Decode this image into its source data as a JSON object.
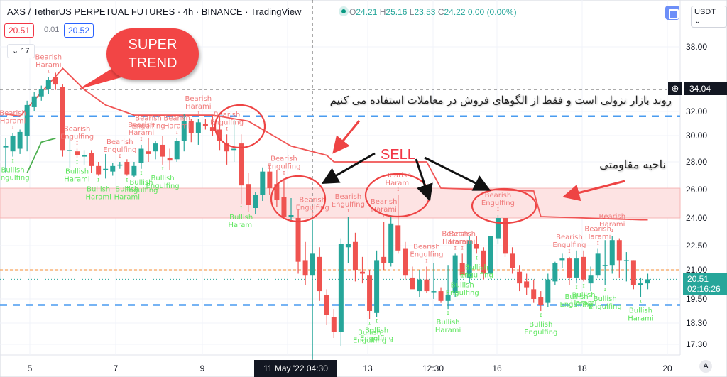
{
  "header": {
    "title": "AXS / TetherUS PERPETUAL FUTURES · 4h · BINANCE · TradingView",
    "ohlc": {
      "o_label": "O",
      "o": "24.21",
      "h_label": "H",
      "h": "25.16",
      "l_label": "L",
      "l": "23.53",
      "c_label": "C",
      "c": "24.22",
      "change": "0.00 (0.00%)"
    },
    "sell_price": "20.51",
    "spread": "0.01",
    "buy_price": "20.52",
    "indicator_count": "17",
    "currency": "USDT"
  },
  "price_axis": {
    "ticks": [
      "38.00",
      "32.00",
      "30.00",
      "28.00",
      "26.00",
      "24.00",
      "22.50",
      "21.00",
      "19.50",
      "18.30",
      "17.30"
    ],
    "crosshair_price": "34.04",
    "last_price": "20.51",
    "countdown": "02:16:26",
    "auto_label": "A"
  },
  "time_axis": {
    "ticks": [
      "5",
      "7",
      "9",
      "13",
      "12:30",
      "16",
      "18",
      "20"
    ],
    "crosshair_time": "11 May '22  04:30"
  },
  "annotations": {
    "bubble_line1": "SUPER",
    "bubble_line2": "TREND",
    "persian_trend": "روند بازار نزولی است و فقط از الگوهای فروش در معاملات استفاده می کنیم",
    "persian_zone": "ناحیه مقاومتی",
    "sell": "SELL"
  },
  "colors": {
    "up": "#26a69a",
    "down": "#ef5350",
    "bearish_label": "#f07a7a",
    "bullish_label": "#5ee65e",
    "supertrend_down": "#f05454",
    "supertrend_up": "#4caf50",
    "zone": "#fde3e3",
    "level_blue": "#4a9cf0",
    "level_orange": "#f7a35c"
  },
  "chart_data": {
    "type": "candlestick",
    "symbol": "AXS / TetherUS PERPETUAL FUTURES",
    "interval": "4h",
    "y_ticks": [
      38,
      32,
      30,
      28,
      26,
      24,
      22.5,
      21,
      19.5,
      18.3,
      17.3
    ],
    "candles": [
      [
        29.1,
        29.8,
        27.2,
        29.2
      ],
      [
        28.8,
        30.2,
        28.4,
        30.0
      ],
      [
        29.0,
        30.5,
        28.6,
        30.3
      ],
      [
        30.0,
        33.0,
        28.8,
        32.6
      ],
      [
        32.4,
        33.8,
        32.0,
        33.4
      ],
      [
        33.4,
        34.4,
        33.0,
        34.1
      ],
      [
        34.1,
        35.2,
        33.6,
        34.9
      ],
      [
        35.2,
        35.6,
        34.0,
        34.5
      ],
      [
        34.3,
        34.5,
        28.4,
        28.9
      ],
      [
        28.9,
        30.0,
        27.6,
        28.9
      ],
      [
        28.8,
        29.0,
        28.3,
        28.5
      ],
      [
        28.4,
        28.9,
        27.8,
        28.5
      ],
      [
        28.7,
        28.9,
        27.2,
        27.7
      ],
      [
        27.7,
        28.0,
        27.0,
        27.1
      ],
      [
        27.5,
        28.6,
        26.8,
        27.5
      ],
      [
        27.3,
        27.9,
        27.0,
        27.7
      ],
      [
        27.8,
        28.0,
        27.5,
        27.8
      ],
      [
        28.0,
        28.2,
        27.0,
        27.1
      ],
      [
        27.0,
        28.0,
        26.9,
        27.7
      ],
      [
        27.9,
        29.3,
        27.5,
        29.0
      ],
      [
        28.8,
        29.8,
        28.0,
        28.6
      ],
      [
        28.8,
        29.6,
        28.2,
        29.4
      ],
      [
        29.3,
        30.0,
        27.8,
        28.4
      ],
      [
        28.3,
        29.0,
        27.4,
        28.1
      ],
      [
        28.2,
        29.8,
        28.0,
        29.6
      ],
      [
        29.6,
        31.8,
        28.8,
        31.2
      ],
      [
        31.2,
        31.4,
        29.5,
        30.2
      ],
      [
        30.2,
        31.4,
        29.3,
        31.1
      ],
      [
        31.0,
        31.4,
        30.5,
        30.8
      ],
      [
        30.7,
        31.6,
        30.0,
        30.4
      ],
      [
        30.5,
        31.6,
        28.9,
        29.6
      ],
      [
        29.4,
        30.1,
        27.8,
        28.8
      ],
      [
        28.9,
        31.3,
        28.0,
        29.0
      ],
      [
        29.4,
        30.1,
        25.0,
        26.3
      ],
      [
        26.4,
        27.2,
        24.4,
        24.9
      ],
      [
        24.7,
        25.8,
        24.3,
        25.6
      ],
      [
        25.6,
        27.6,
        25.2,
        27.3
      ],
      [
        27.3,
        27.7,
        25.6,
        26.1
      ],
      [
        26.4,
        27.4,
        24.8,
        25.3
      ],
      [
        25.5,
        26.8,
        24.6,
        24.1
      ],
      [
        24.1,
        25.4,
        23.8,
        24.2
      ],
      [
        24.0,
        24.6,
        20.8,
        21.5
      ],
      [
        21.6,
        22.7,
        20.2,
        20.7
      ],
      [
        20.7,
        23.9,
        16.6,
        22.0
      ],
      [
        21.8,
        22.4,
        19.4,
        19.9
      ],
      [
        19.7,
        20.0,
        18.2,
        18.7
      ],
      [
        18.6,
        19.0,
        17.6,
        17.9
      ],
      [
        17.9,
        22.9,
        17.2,
        22.6
      ],
      [
        22.4,
        24.1,
        21.4,
        22.6
      ],
      [
        22.7,
        23.2,
        20.4,
        21.0
      ],
      [
        20.9,
        21.8,
        20.3,
        20.8
      ],
      [
        20.7,
        21.0,
        18.5,
        18.9
      ],
      [
        18.8,
        22.2,
        18.6,
        21.6
      ],
      [
        21.8,
        23.8,
        21.0,
        21.4
      ],
      [
        21.4,
        24.2,
        21.2,
        23.7
      ],
      [
        23.6,
        25.6,
        22.0,
        22.2
      ],
      [
        22.3,
        22.7,
        20.5,
        20.7
      ],
      [
        20.6,
        21.2,
        20.2,
        20.0
      ],
      [
        19.9,
        21.0,
        19.6,
        20.5
      ],
      [
        20.5,
        21.2,
        19.8,
        19.9
      ],
      [
        19.9,
        21.4,
        19.5,
        19.9
      ],
      [
        19.9,
        20.1,
        19.3,
        19.4
      ],
      [
        19.4,
        21.3,
        19.0,
        19.7
      ],
      [
        19.8,
        22.0,
        19.6,
        21.9
      ],
      [
        21.4,
        22.0,
        20.9,
        20.7
      ],
      [
        20.6,
        23.0,
        20.3,
        22.8
      ],
      [
        22.6,
        23.0,
        22.0,
        22.3
      ],
      [
        22.2,
        22.4,
        20.5,
        20.8
      ],
      [
        20.8,
        23.0,
        20.6,
        23.0
      ],
      [
        22.9,
        24.2,
        22.6,
        24.0
      ],
      [
        24.0,
        24.0,
        21.8,
        22.0
      ],
      [
        22.0,
        22.4,
        20.8,
        21.1
      ],
      [
        20.9,
        21.3,
        19.9,
        20.3
      ],
      [
        20.4,
        20.8,
        19.7,
        20.1
      ],
      [
        20.0,
        20.5,
        19.3,
        19.5
      ],
      [
        19.6,
        19.9,
        18.9,
        19.2
      ],
      [
        19.3,
        20.8,
        19.1,
        20.5
      ],
      [
        20.4,
        21.5,
        20.2,
        21.4
      ],
      [
        21.6,
        22.0,
        21.1,
        21.7
      ],
      [
        21.7,
        21.8,
        20.2,
        20.6
      ],
      [
        20.6,
        22.2,
        20.3,
        21.7
      ],
      [
        21.8,
        22.2,
        20.4,
        20.5
      ],
      [
        20.3,
        21.2,
        19.9,
        20.7
      ],
      [
        20.7,
        22.3,
        20.6,
        22.0
      ],
      [
        21.3,
        22.8,
        20.2,
        21.3
      ],
      [
        21.3,
        23.0,
        20.8,
        22.8
      ],
      [
        22.8,
        22.9,
        20.6,
        21.6
      ],
      [
        21.6,
        22.1,
        20.4,
        21.6
      ],
      [
        21.6,
        21.6,
        20.0,
        20.2
      ],
      [
        20.2,
        20.6,
        19.6,
        20.3
      ],
      [
        20.3,
        20.8,
        20.0,
        20.51
      ]
    ],
    "patterns": [
      {
        "i": 1,
        "label": "Bearish Harami",
        "pos": "above"
      },
      {
        "i": 1,
        "label": "Bullish Engulfing",
        "pos": "below"
      },
      {
        "i": 6,
        "label": "Bearish Harami",
        "pos": "above"
      },
      {
        "i": 10,
        "label": "Bearish Engulfing",
        "pos": "above"
      },
      {
        "i": 10,
        "label": "Bullish Harami",
        "pos": "below"
      },
      {
        "i": 13,
        "label": "Bullish Harami",
        "pos": "below"
      },
      {
        "i": 16,
        "label": "Bearish Engulfing",
        "pos": "above"
      },
      {
        "i": 17,
        "label": "Bullish Harami",
        "pos": "below"
      },
      {
        "i": 19,
        "label": "Bearish Harami",
        "pos": "above"
      },
      {
        "i": 20,
        "label": "Bearish Engulfing",
        "pos": "above"
      },
      {
        "i": 19,
        "label": "Bullish Engulfing",
        "pos": "below"
      },
      {
        "i": 22,
        "label": "Bullish Engulfing",
        "pos": "below"
      },
      {
        "i": 24,
        "label": "Bearish Harami",
        "pos": "above"
      },
      {
        "i": 27,
        "label": "Bearish Harami",
        "pos": "above"
      },
      {
        "i": 31,
        "label": "Bearish Engulfing",
        "pos": "above"
      },
      {
        "i": 33,
        "label": "Bullish Harami",
        "pos": "below"
      },
      {
        "i": 39,
        "label": "Bearish Engulfing",
        "pos": "above"
      },
      {
        "i": 43,
        "label": "Bearish Engulfing",
        "pos": "above"
      },
      {
        "i": 48,
        "label": "Bearish Engulfing",
        "pos": "above"
      },
      {
        "i": 53,
        "label": "Bearish Harami",
        "pos": "above"
      },
      {
        "i": 55,
        "label": "Bearish Harami",
        "pos": "above"
      },
      {
        "i": 52,
        "label": "Bullish Engulfing",
        "pos": "below"
      },
      {
        "i": 59,
        "label": "Bearish Engulfing",
        "pos": "above"
      },
      {
        "i": 51,
        "label": "Bullish Engulfing",
        "pos": "below"
      },
      {
        "i": 62,
        "label": "Bullish Harami",
        "pos": "below"
      },
      {
        "i": 63,
        "label": "Bearish Harami",
        "pos": "above"
      },
      {
        "i": 64,
        "label": "Bearish Harami",
        "pos": "above"
      },
      {
        "i": 64,
        "label": "Bullish Engulfing",
        "pos": "below"
      },
      {
        "i": 66,
        "label": "Bullish Engulfing",
        "pos": "below"
      },
      {
        "i": 69,
        "label": "Bearish Engulfing",
        "pos": "above"
      },
      {
        "i": 75,
        "label": "Bullish Engulfing",
        "pos": "below"
      },
      {
        "i": 79,
        "label": "Bearish Engulfing",
        "pos": "above"
      },
      {
        "i": 80,
        "label": "Bullish Engulfing",
        "pos": "below"
      },
      {
        "i": 81,
        "label": "Bullish Harami",
        "pos": "below"
      },
      {
        "i": 83,
        "label": "Bearish Harami",
        "pos": "above"
      },
      {
        "i": 84,
        "label": "Bullish Engulfing",
        "pos": "below"
      },
      {
        "i": 85,
        "label": "Bearish Harami",
        "pos": "above"
      },
      {
        "i": 89,
        "label": "Bullish Harami",
        "pos": "below"
      }
    ],
    "supertrend_down": [
      [
        0,
        31.8
      ],
      [
        2,
        31.6
      ],
      [
        8,
        36
      ],
      [
        11,
        34.04
      ],
      [
        14,
        32.6
      ],
      [
        18,
        31.7
      ],
      [
        29,
        31.7
      ],
      [
        34,
        31.2
      ],
      [
        40,
        29.2
      ],
      [
        45,
        28.5
      ],
      [
        46,
        28
      ],
      [
        59,
        28
      ],
      [
        61,
        26.1
      ],
      [
        74,
        25.9
      ],
      [
        75,
        24.1
      ],
      [
        89,
        23.9
      ],
      [
        90,
        23.9
      ]
    ],
    "supertrend_up": [
      [
        3,
        27.2
      ],
      [
        5,
        29.5
      ],
      [
        7,
        29.8
      ]
    ],
    "resistance_zone": [
      24.0,
      26.1
    ],
    "levels": {
      "blue_upper": 31.6,
      "blue_lower": 19.2,
      "orange_current": 21.0,
      "crosshair": 34.04
    }
  }
}
